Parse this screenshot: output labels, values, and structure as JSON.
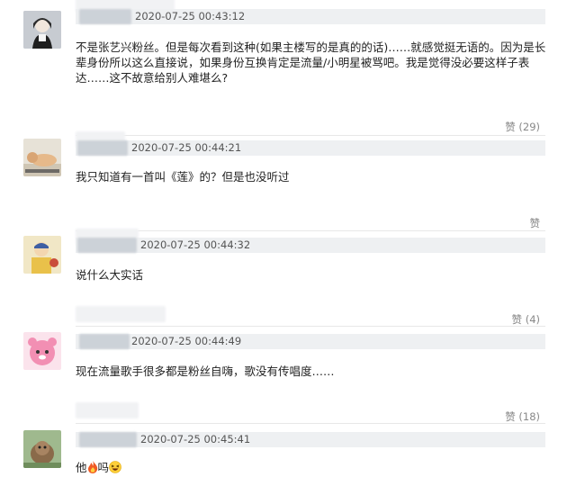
{
  "comments": [
    {
      "time": "2020-07-25 00:43:12",
      "text": "不是张艺兴粉丝。但是每次看到这种(如果主楼写的是真的的话)……就感觉挺无语的。因为是长辈身份所以这么直接说，如果身份互换肯定是流量/小明星被骂吧。我是觉得没必要这样子表达……这不故意给别人难堪么?",
      "likes": "赞 (29)",
      "avatar": "anime-girl-avatar"
    },
    {
      "time": "2020-07-25 00:44:21",
      "text": "我只知道有一首叫《莲》的？但是也没听过",
      "likes": "赞",
      "avatar": "dog-photo-avatar"
    },
    {
      "time": "2020-07-25 00:44:32",
      "text": "说什么大实话",
      "likes": "",
      "avatar": "cartoon-character-avatar"
    },
    {
      "time": "2020-07-25 00:44:49",
      "text": "现在流量歌手很多都是粉丝自嗨，歌没有传唱度……",
      "likes": "赞 (4)",
      "avatar": "pink-bear-avatar"
    },
    {
      "time": "2020-07-25 00:45:41",
      "text_prefix": "他",
      "text_mid": "吗",
      "likes": "赞 (18)",
      "avatar": "animal-photo-avatar"
    }
  ],
  "colors": {
    "name_bar": "#eef0f2",
    "likes": "#888888",
    "text": "#222222"
  },
  "icons": [
    "fire-emoji",
    "laughing-emoji"
  ]
}
